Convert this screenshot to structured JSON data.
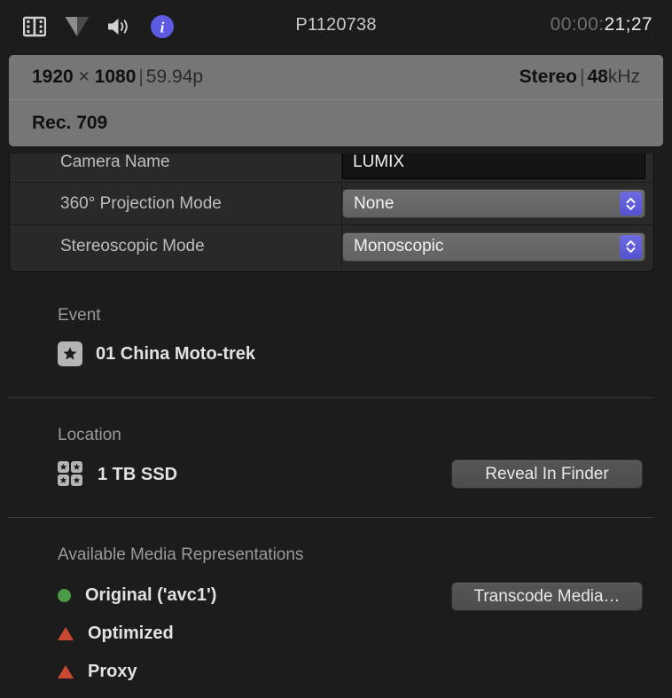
{
  "toolbar": {
    "icons": [
      {
        "name": "film-strip-icon",
        "label": "Video"
      },
      {
        "name": "color-triangle-icon",
        "label": "Color"
      },
      {
        "name": "speaker-icon",
        "label": "Audio"
      },
      {
        "name": "info-icon",
        "label": "Info"
      }
    ],
    "clip_title": "P1120738",
    "timecode_dim": "00:00:",
    "timecode_bright": "21;27",
    "active_icon_color": "#5d5be2"
  },
  "metadata_banner": {
    "resolution_width": "1920",
    "resolution_times": "×",
    "resolution_height": "1080",
    "divider1": "|",
    "frame_rate": "59.94p",
    "audio_channels": "Stereo",
    "divider2": "|",
    "sample_rate_num": "48",
    "sample_rate_unit": "kHz",
    "color_space": "Rec. 709"
  },
  "form_rows": [
    {
      "label": "Camera Name",
      "value": "LUMIX",
      "control": "text-field"
    },
    {
      "label": "360° Projection Mode",
      "value": "None",
      "control": "popup"
    },
    {
      "label": "Stereoscopic Mode",
      "value": "Monoscopic",
      "control": "popup"
    }
  ],
  "event_section": {
    "title": "Event",
    "item_label": "01 China Moto-trek",
    "icon": "star-icon"
  },
  "location_section": {
    "title": "Location",
    "item_label": "1 TB SSD",
    "icon": "library-icon",
    "button_label": "Reveal In Finder"
  },
  "media_section": {
    "title": "Available Media Representations",
    "button_label": "Transcode Media…",
    "items": [
      {
        "label": "Original ('avc1')",
        "status": "available",
        "marker": "dot-green",
        "color": "#4a9a48"
      },
      {
        "label": "Optimized",
        "status": "unavailable",
        "marker": "tri-red",
        "color": "#c9482f"
      },
      {
        "label": "Proxy",
        "status": "unavailable",
        "marker": "tri-red",
        "color": "#c9482f"
      }
    ]
  }
}
